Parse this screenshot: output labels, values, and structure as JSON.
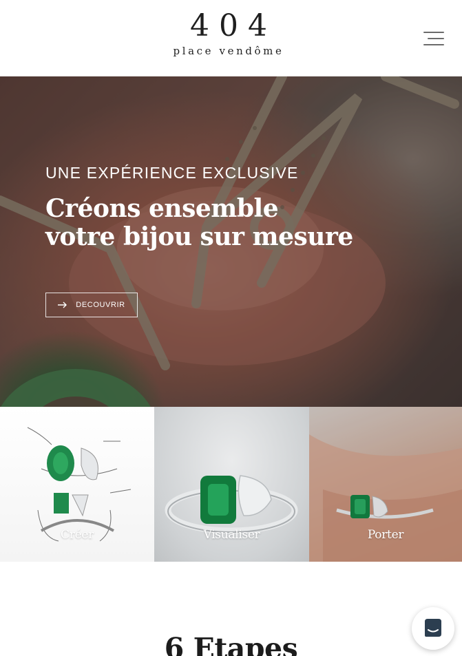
{
  "header": {
    "logo_number": "404",
    "logo_subtitle": "place vendôme",
    "menu_icon": "hamburger-menu-icon"
  },
  "hero": {
    "eyebrow": "UNE EXPÉRIENCE EXCLUSIVE",
    "title_line1": "Créons ensemble",
    "title_line2": "votre bijou sur mesure",
    "cta_label": "DECOUVRIR",
    "cta_icon": "arrow-right-icon"
  },
  "tiles": [
    {
      "label": "Créer"
    },
    {
      "label": "Visualiser"
    },
    {
      "label": "Porter"
    }
  ],
  "steps": {
    "heading": "6 Etapes"
  },
  "chat": {
    "icon": "chat-bubble-icon",
    "color": "#2c3e50"
  },
  "colors": {
    "emerald": "#1f8a4c",
    "text_dark": "#1c1c1c",
    "menu_gray": "#6b6b6b"
  }
}
